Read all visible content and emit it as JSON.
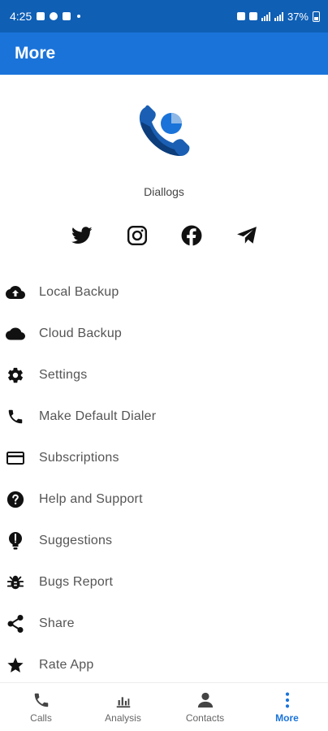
{
  "status_bar": {
    "time": "4:25",
    "battery": "37%"
  },
  "app_bar": {
    "title": "More"
  },
  "app": {
    "name": "Diallogs"
  },
  "social": [
    {
      "name": "twitter",
      "icon": "twitter-icon"
    },
    {
      "name": "instagram",
      "icon": "instagram-icon"
    },
    {
      "name": "facebook",
      "icon": "facebook-icon"
    },
    {
      "name": "telegram",
      "icon": "telegram-icon"
    }
  ],
  "menu": {
    "items": [
      {
        "label": "Local Backup",
        "icon": "cloud-upload-icon"
      },
      {
        "label": "Cloud Backup",
        "icon": "cloud-icon"
      },
      {
        "label": "Settings",
        "icon": "gear-icon"
      },
      {
        "label": "Make Default Dialer",
        "icon": "phone-icon"
      },
      {
        "label": "Subscriptions",
        "icon": "card-icon"
      },
      {
        "label": "Help and Support",
        "icon": "help-icon"
      },
      {
        "label": "Suggestions",
        "icon": "lightbulb-icon"
      },
      {
        "label": "Bugs Report",
        "icon": "bug-icon"
      },
      {
        "label": "Share",
        "icon": "share-icon"
      },
      {
        "label": "Rate App",
        "icon": "star-icon"
      }
    ]
  },
  "bottom_nav": {
    "items": [
      {
        "label": "Calls",
        "icon": "phone-icon",
        "active": false
      },
      {
        "label": "Analysis",
        "icon": "bar-chart-icon",
        "active": false
      },
      {
        "label": "Contacts",
        "icon": "person-icon",
        "active": false
      },
      {
        "label": "More",
        "icon": "more-vertical-icon",
        "active": true
      }
    ]
  },
  "colors": {
    "status_bar": "#0f5fb5",
    "app_bar": "#1a73d9",
    "accent": "#1a73d9"
  }
}
